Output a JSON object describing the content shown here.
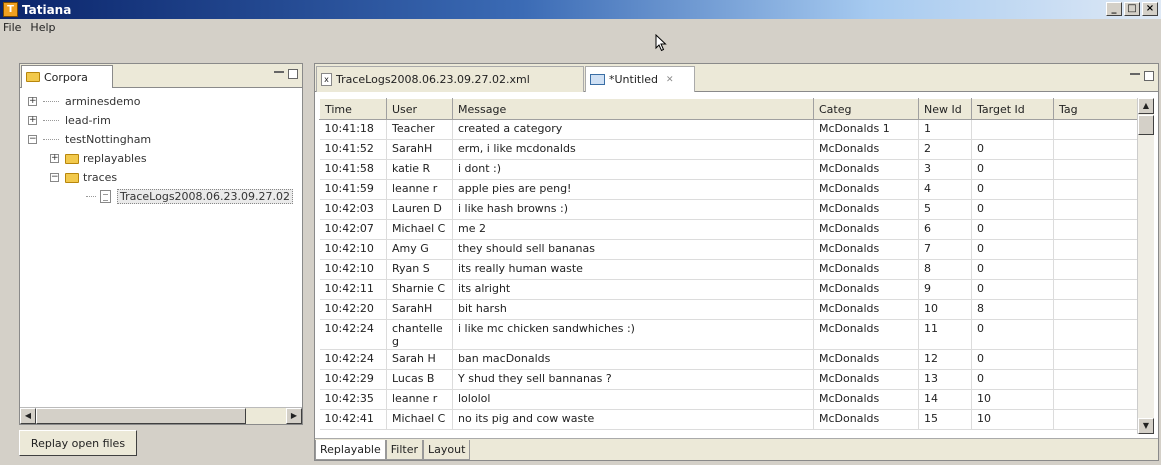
{
  "window": {
    "title": "Tatiana",
    "controls": [
      "_",
      "□",
      "×"
    ]
  },
  "menu": [
    "File",
    "Help"
  ],
  "left_panel": {
    "tab_label": "Corpora",
    "tree": [
      {
        "label": "arminesdemo",
        "level": 0,
        "expander": "+"
      },
      {
        "label": "lead-rim",
        "level": 0,
        "expander": "+"
      },
      {
        "label": "testNottingham",
        "level": 0,
        "expander": "−"
      },
      {
        "label": "replayables",
        "level": 1,
        "expander": "+",
        "icon": "folder"
      },
      {
        "label": "traces",
        "level": 1,
        "expander": "−",
        "icon": "folder"
      },
      {
        "label": "TraceLogs2008.06.23.09.27.02",
        "level": 2,
        "icon": "file",
        "selected": true
      }
    ],
    "replay_button": "Replay open files"
  },
  "editor": {
    "tabs": [
      {
        "label": "TraceLogs2008.06.23.09.27.02.xml",
        "active": false
      },
      {
        "label": "*Untitled",
        "active": true
      }
    ],
    "columns": [
      "Time",
      "User",
      "Message",
      "Categ",
      "New Id",
      "Target Id",
      "Tag"
    ],
    "rows": [
      [
        "10:41:18",
        "Teacher",
        "created a category",
        "McDonalds 1",
        "1",
        "",
        ""
      ],
      [
        "10:41:52",
        "SarahH",
        "erm, i like mcdonalds",
        "McDonalds",
        "2",
        "0",
        ""
      ],
      [
        "10:41:58",
        "katie R",
        "i dont :)",
        "McDonalds",
        "3",
        "0",
        ""
      ],
      [
        "10:41:59",
        "leanne r",
        "apple pies are peng!",
        "McDonalds",
        "4",
        "0",
        ""
      ],
      [
        "10:42:03",
        "Lauren D",
        "i like hash browns :)",
        "McDonalds",
        "5",
        "0",
        ""
      ],
      [
        "10:42:07",
        "Michael C",
        "me 2",
        "McDonalds",
        "6",
        "0",
        ""
      ],
      [
        "10:42:10",
        "Amy G",
        "they should sell bananas",
        "McDonalds",
        "7",
        "0",
        ""
      ],
      [
        "10:42:10",
        "Ryan S",
        "its really human waste",
        "McDonalds",
        "8",
        "0",
        ""
      ],
      [
        "10:42:11",
        "Sharnie C",
        "its alright",
        "McDonalds",
        "9",
        "0",
        ""
      ],
      [
        "10:42:20",
        "SarahH",
        "bit harsh",
        "McDonalds",
        "10",
        "8",
        ""
      ],
      [
        "10:42:24",
        "chantelle g",
        "i like mc chicken sandwhiches :)",
        "McDonalds",
        "11",
        "0",
        ""
      ],
      [
        "10:42:24",
        "Sarah H",
        "ban macDonalds",
        "McDonalds",
        "12",
        "0",
        ""
      ],
      [
        "10:42:29",
        "Lucas B",
        "Y shud they sell bannanas ?",
        "McDonalds",
        "13",
        "0",
        ""
      ],
      [
        "10:42:35",
        "leanne r",
        "lololol",
        "McDonalds",
        "14",
        "10",
        ""
      ],
      [
        "10:42:41",
        "Michael C",
        "no its pig and cow waste",
        "McDonalds",
        "15",
        "10",
        ""
      ]
    ],
    "bottom_tabs": [
      "Replayable",
      "Filter",
      "Layout"
    ]
  }
}
